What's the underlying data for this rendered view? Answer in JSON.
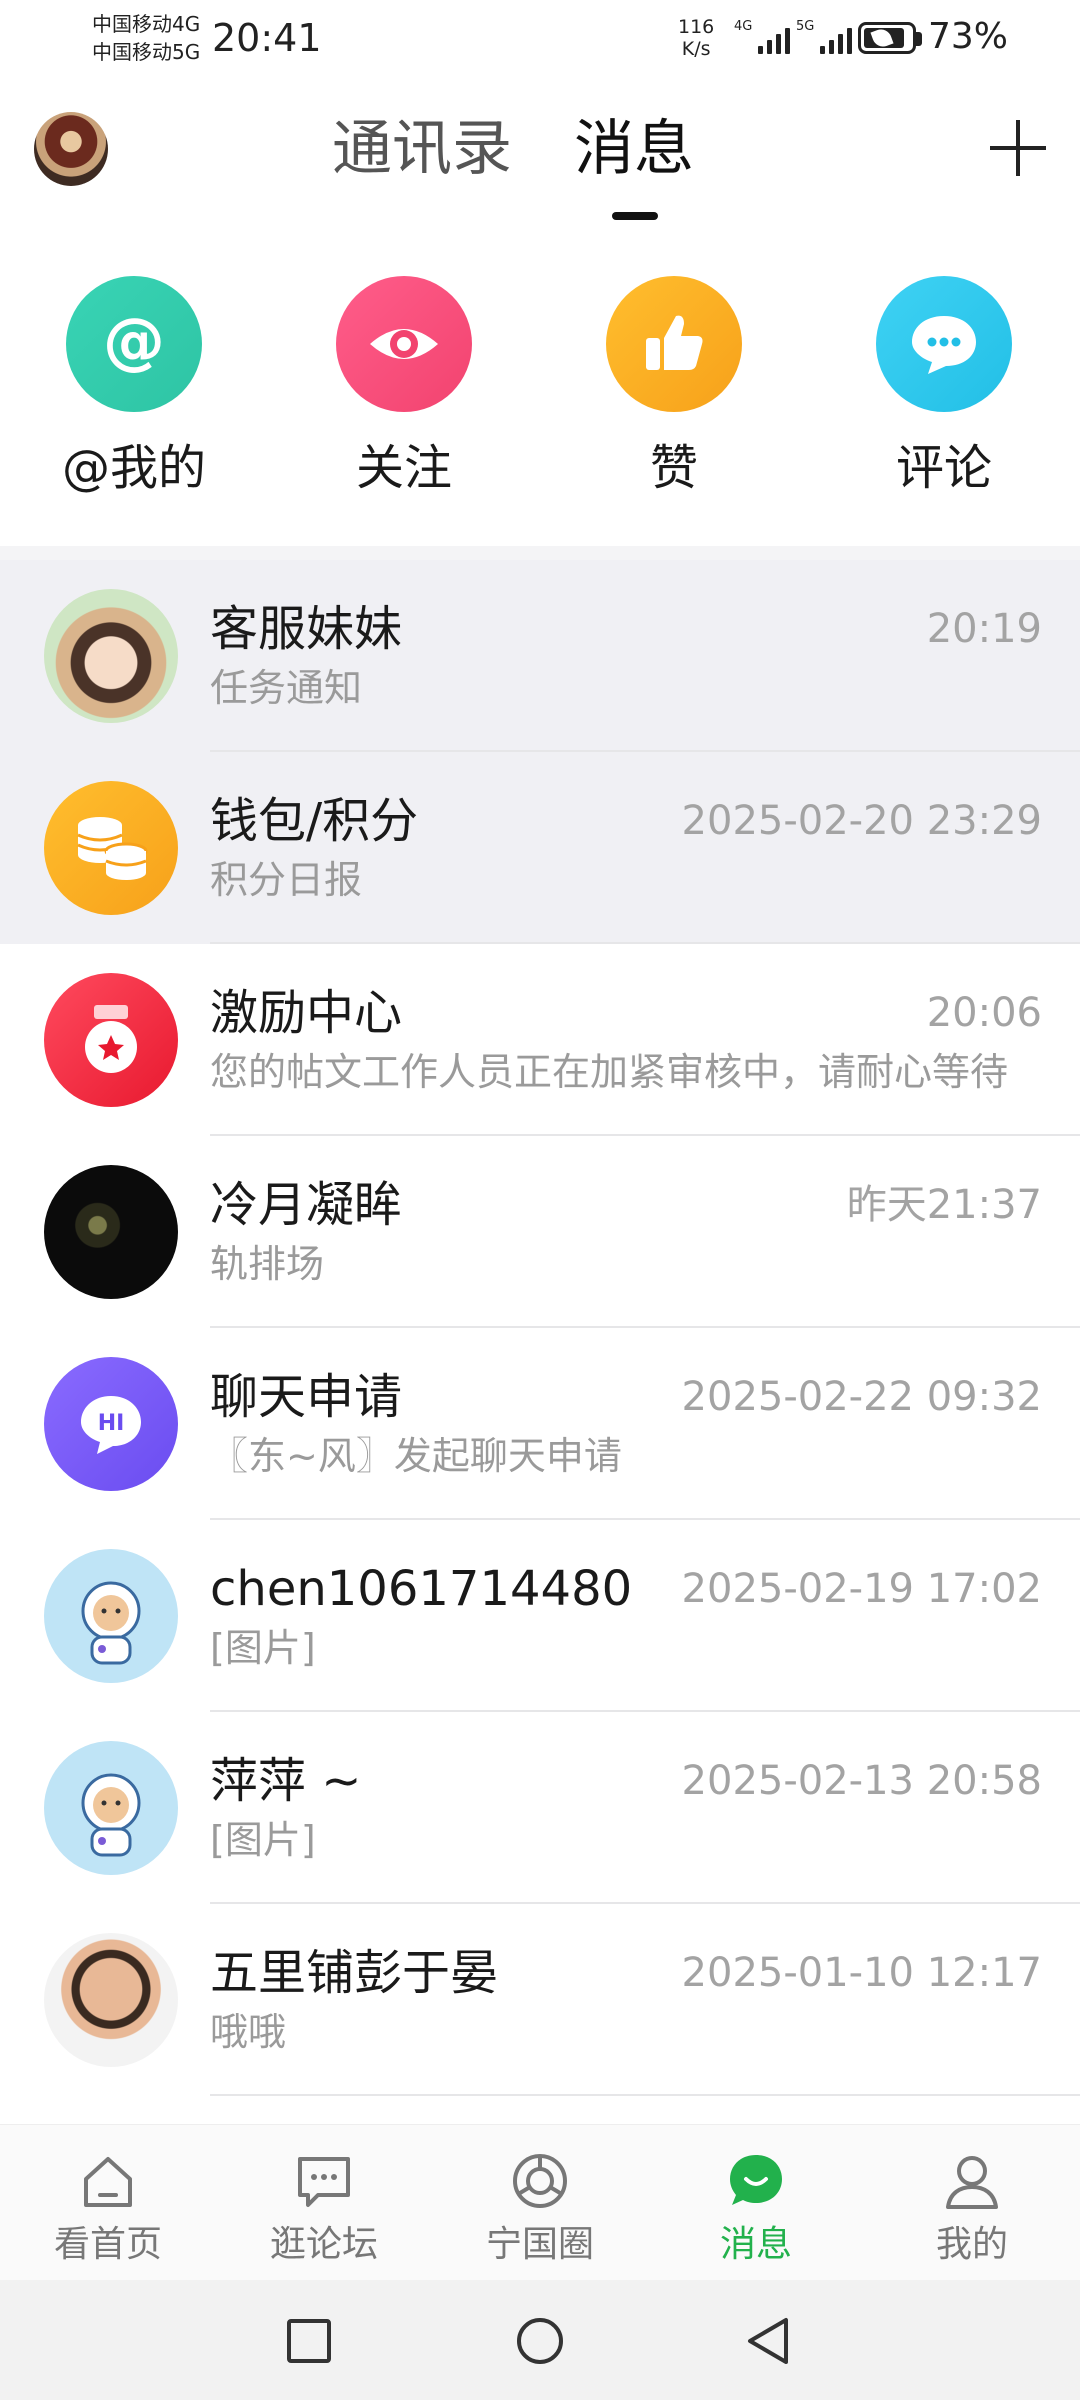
{
  "status_bar": {
    "carrier_1": "中国移动4G",
    "carrier_2": "中国移动5G",
    "time": "20:41",
    "net_speed_value": "116",
    "net_speed_unit": "K/s",
    "signal_1_tag": "4G",
    "signal_2_tag": "5G",
    "battery": "73%"
  },
  "header": {
    "tabs": [
      {
        "label": "通讯录",
        "active": false
      },
      {
        "label": "消息",
        "active": true
      }
    ]
  },
  "quick_actions": [
    {
      "label": "@我的",
      "icon": "at-icon"
    },
    {
      "label": "关注",
      "icon": "eye-icon"
    },
    {
      "label": "赞",
      "icon": "thumbs-up-icon"
    },
    {
      "label": "评论",
      "icon": "comment-icon"
    }
  ],
  "messages": [
    {
      "name": "客服妹妹",
      "preview": "任务通知",
      "time": "20:19",
      "pinned": true,
      "avatar": "girl-photo"
    },
    {
      "name": "钱包/积分",
      "preview": "积分日报",
      "time": "2025-02-20 23:29",
      "pinned": true,
      "avatar": "coins-icon"
    },
    {
      "name": "激励中心",
      "preview": "您的帖文工作人员正在加紧审核中，请耐心等待",
      "time": "20:06",
      "pinned": false,
      "avatar": "medal-icon"
    },
    {
      "name": "冷月凝眸",
      "preview": "轨排场",
      "time": "昨天21:37",
      "pinned": false,
      "avatar": "night-photo"
    },
    {
      "name": "聊天申请",
      "preview": "〖东~风〗发起聊天申请",
      "time": "2025-02-22 09:32",
      "pinned": false,
      "avatar": "hi-chat-icon"
    },
    {
      "name": "chen1061714480",
      "preview": "[图片]",
      "time": "2025-02-19 17:02",
      "pinned": false,
      "avatar": "astronaut-cartoon"
    },
    {
      "name": "萍萍 ~",
      "preview": "[图片]",
      "time": "2025-02-13 20:58",
      "pinned": false,
      "avatar": "astronaut-cartoon"
    },
    {
      "name": "五里铺彭于晏",
      "preview": "哦哦",
      "time": "2025-01-10 12:17",
      "pinned": false,
      "avatar": "man-photo"
    }
  ],
  "bottom_nav": [
    {
      "label": "看首页",
      "icon": "home-icon",
      "active": false
    },
    {
      "label": "逛论坛",
      "icon": "forum-icon",
      "active": false
    },
    {
      "label": "宁国圈",
      "icon": "circle-icon",
      "active": false
    },
    {
      "label": "消息",
      "icon": "message-icon",
      "active": true
    },
    {
      "label": "我的",
      "icon": "profile-icon",
      "active": false
    }
  ],
  "colors": {
    "accent_green": "#22b14c",
    "at_teal": "#2ec4a4",
    "follow_pink": "#f2436f",
    "like_orange": "#f7a11a",
    "comment_blue": "#22bfe6",
    "pinned_bg": "#f0f0f4"
  }
}
